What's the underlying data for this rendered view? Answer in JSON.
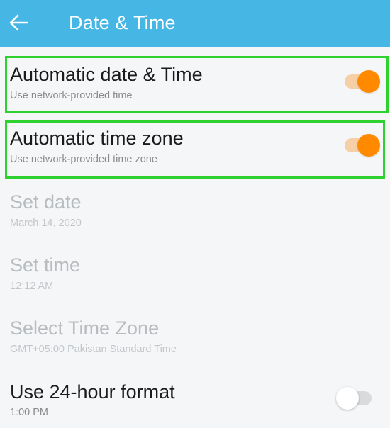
{
  "appbar": {
    "title": "Date & Time",
    "back_icon": "arrow-left-icon",
    "color": "#46b6e4"
  },
  "settings": [
    {
      "id": "automatic-date-time",
      "title": "Automatic date & Time",
      "subtitle": "Use network-provided time",
      "toggle": true,
      "checked": true,
      "enabled": true,
      "highlighted": true
    },
    {
      "id": "automatic-time-zone",
      "title": "Automatic time zone",
      "subtitle": "Use network-provided time zone",
      "toggle": true,
      "checked": true,
      "enabled": true,
      "highlighted": true
    },
    {
      "id": "set-date",
      "title": "Set date",
      "subtitle": "March 14, 2020",
      "toggle": false,
      "enabled": false
    },
    {
      "id": "set-time",
      "title": "Set time",
      "subtitle": "12:12 AM",
      "toggle": false,
      "enabled": false
    },
    {
      "id": "select-time-zone",
      "title": "Select Time Zone",
      "subtitle": "GMT+05:00 Pakistan Standard Time",
      "toggle": false,
      "enabled": false
    },
    {
      "id": "use-24-hour-format",
      "title": "Use 24-hour format",
      "subtitle": "1:00 PM",
      "toggle": true,
      "checked": false,
      "enabled": true
    }
  ],
  "colors": {
    "accent": "#ff8a00",
    "highlight": "#2fd12f",
    "background": "#f4f6f8"
  }
}
